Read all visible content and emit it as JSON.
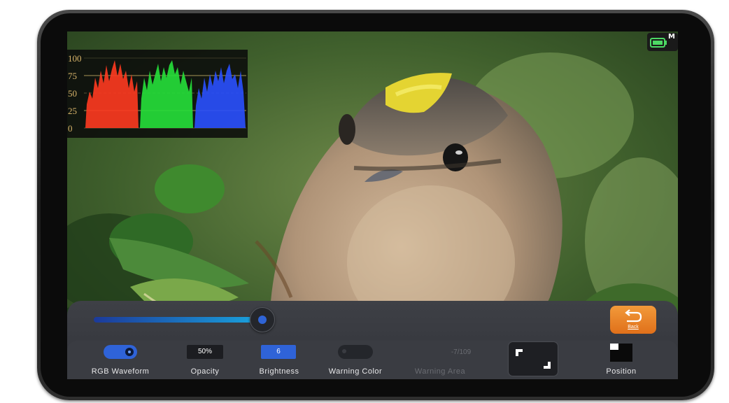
{
  "status": {
    "battery_icon": "battery-icon",
    "battery_mode": "M"
  },
  "waveform": {
    "ticks": [
      "100",
      "75",
      "50",
      "25",
      "0"
    ],
    "channels": [
      "red",
      "green",
      "blue"
    ]
  },
  "slider": {
    "level": 0.97
  },
  "back": {
    "label": "Back",
    "icon": "return-arrow-icon"
  },
  "controls": {
    "rgb_waveform": {
      "label": "RGB Waveform",
      "enabled": true
    },
    "opacity": {
      "label": "Opacity",
      "value": "50%"
    },
    "brightness": {
      "label": "Brightness",
      "value": "6"
    },
    "warning_color": {
      "label": "Warning Color",
      "enabled": false
    },
    "warning_area": {
      "label": "Warning Area",
      "value": "-7/109"
    },
    "fullscreen": {
      "icon": "fullscreen-icon"
    },
    "position": {
      "label": "Position",
      "icon": "position-icon"
    }
  },
  "colors": {
    "accent_blue": "#2f63d8",
    "back_orange": "#ee8a2c",
    "panel": "#3a3c42",
    "tick_color": "#d8b46a"
  }
}
